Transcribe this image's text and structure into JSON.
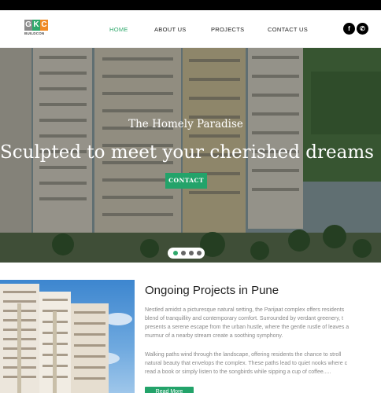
{
  "header": {
    "logo": {
      "letters": [
        "G",
        "K",
        "C"
      ],
      "subtitle": "BUILDCON"
    },
    "nav": [
      {
        "label": "HOME",
        "active": true
      },
      {
        "label": "ABOUT US",
        "active": false
      },
      {
        "label": "PROJECTS",
        "active": false
      },
      {
        "label": "CONTACT US",
        "active": false
      }
    ],
    "social": [
      {
        "icon": "facebook-icon",
        "glyph": "f"
      },
      {
        "icon": "whatsapp-icon",
        "glyph": "✆"
      }
    ]
  },
  "hero": {
    "subtitle": "The Homely Paradise",
    "title": "Sculpted to meet your cherished dreams",
    "button_label": "CONTACT",
    "slide_count": 4,
    "active_slide": 1
  },
  "projects": {
    "title": "Ongoing Projects in Pune",
    "paragraph1": [
      "Nestled amidst a picturesque natural setting, the Parijaat complex offers residents",
      "blend of tranquillity and contemporary comfort. Surrounded by verdant greenery, t",
      "presents a serene escape from the urban hustle, where the gentle rustle of leaves a",
      "murmur of a nearby stream create a soothing symphony."
    ],
    "paragraph2": [
      "Walking paths wind through the landscape, offering residents the chance to stroll",
      "natural beauty that envelops the complex. These paths lead to quiet nooks where c",
      "read a book or simply listen to the songbirds while sipping a cup of coffee....."
    ],
    "button_label": "Read More"
  },
  "colors": {
    "accent": "#23a36a",
    "topbar": "#000000"
  }
}
